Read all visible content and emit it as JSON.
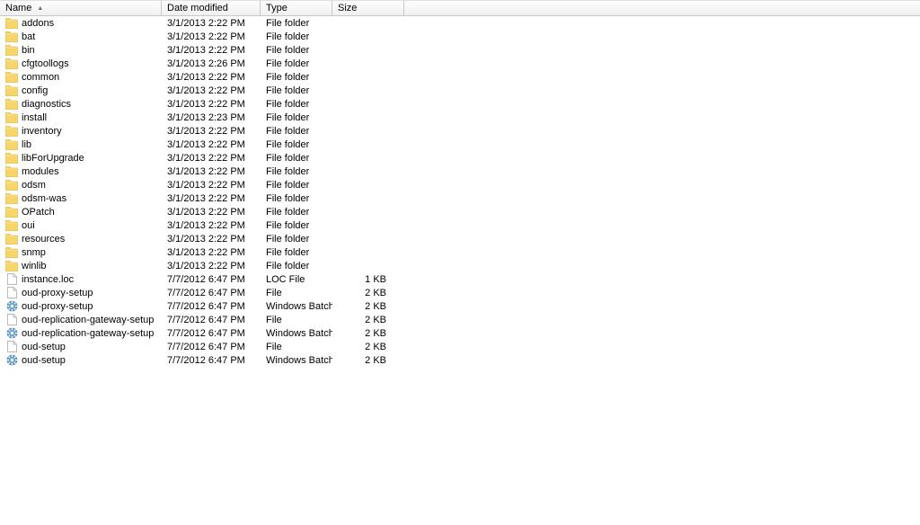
{
  "columns": {
    "name": "Name",
    "date": "Date modified",
    "type": "Type",
    "size": "Size",
    "sortIndicator": "▲"
  },
  "rows": [
    {
      "icon": "folder",
      "name": "addons",
      "date": "3/1/2013 2:22 PM",
      "type": "File folder",
      "size": ""
    },
    {
      "icon": "folder",
      "name": "bat",
      "date": "3/1/2013 2:22 PM",
      "type": "File folder",
      "size": ""
    },
    {
      "icon": "folder",
      "name": "bin",
      "date": "3/1/2013 2:22 PM",
      "type": "File folder",
      "size": ""
    },
    {
      "icon": "folder",
      "name": "cfgtoollogs",
      "date": "3/1/2013 2:26 PM",
      "type": "File folder",
      "size": ""
    },
    {
      "icon": "folder",
      "name": "common",
      "date": "3/1/2013 2:22 PM",
      "type": "File folder",
      "size": ""
    },
    {
      "icon": "folder",
      "name": "config",
      "date": "3/1/2013 2:22 PM",
      "type": "File folder",
      "size": ""
    },
    {
      "icon": "folder",
      "name": "diagnostics",
      "date": "3/1/2013 2:22 PM",
      "type": "File folder",
      "size": ""
    },
    {
      "icon": "folder",
      "name": "install",
      "date": "3/1/2013 2:23 PM",
      "type": "File folder",
      "size": ""
    },
    {
      "icon": "folder",
      "name": "inventory",
      "date": "3/1/2013 2:22 PM",
      "type": "File folder",
      "size": ""
    },
    {
      "icon": "folder",
      "name": "lib",
      "date": "3/1/2013 2:22 PM",
      "type": "File folder",
      "size": ""
    },
    {
      "icon": "folder",
      "name": "libForUpgrade",
      "date": "3/1/2013 2:22 PM",
      "type": "File folder",
      "size": ""
    },
    {
      "icon": "folder",
      "name": "modules",
      "date": "3/1/2013 2:22 PM",
      "type": "File folder",
      "size": ""
    },
    {
      "icon": "folder",
      "name": "odsm",
      "date": "3/1/2013 2:22 PM",
      "type": "File folder",
      "size": ""
    },
    {
      "icon": "folder",
      "name": "odsm-was",
      "date": "3/1/2013 2:22 PM",
      "type": "File folder",
      "size": ""
    },
    {
      "icon": "folder",
      "name": "OPatch",
      "date": "3/1/2013 2:22 PM",
      "type": "File folder",
      "size": ""
    },
    {
      "icon": "folder",
      "name": "oui",
      "date": "3/1/2013 2:22 PM",
      "type": "File folder",
      "size": ""
    },
    {
      "icon": "folder",
      "name": "resources",
      "date": "3/1/2013 2:22 PM",
      "type": "File folder",
      "size": ""
    },
    {
      "icon": "folder",
      "name": "snmp",
      "date": "3/1/2013 2:22 PM",
      "type": "File folder",
      "size": ""
    },
    {
      "icon": "folder",
      "name": "winlib",
      "date": "3/1/2013 2:22 PM",
      "type": "File folder",
      "size": ""
    },
    {
      "icon": "file",
      "name": "instance.loc",
      "date": "7/7/2012 6:47 PM",
      "type": "LOC File",
      "size": "1 KB"
    },
    {
      "icon": "file",
      "name": "oud-proxy-setup",
      "date": "7/7/2012 6:47 PM",
      "type": "File",
      "size": "2 KB"
    },
    {
      "icon": "batch",
      "name": "oud-proxy-setup",
      "date": "7/7/2012 6:47 PM",
      "type": "Windows Batch File",
      "size": "2 KB"
    },
    {
      "icon": "file",
      "name": "oud-replication-gateway-setup",
      "date": "7/7/2012 6:47 PM",
      "type": "File",
      "size": "2 KB"
    },
    {
      "icon": "batch",
      "name": "oud-replication-gateway-setup",
      "date": "7/7/2012 6:47 PM",
      "type": "Windows Batch File",
      "size": "2 KB"
    },
    {
      "icon": "file",
      "name": "oud-setup",
      "date": "7/7/2012 6:47 PM",
      "type": "File",
      "size": "2 KB"
    },
    {
      "icon": "batch",
      "name": "oud-setup",
      "date": "7/7/2012 6:47 PM",
      "type": "Windows Batch File",
      "size": "2 KB"
    }
  ]
}
